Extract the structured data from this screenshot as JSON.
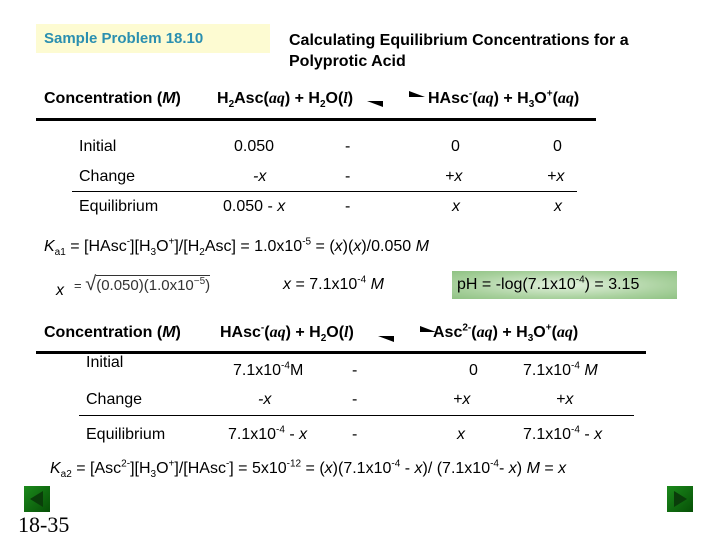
{
  "header": {
    "sample_problem": "Sample Problem 18.10",
    "title_line1": "Calculating Equilibrium Concentrations for a",
    "title_line2": "Polyprotic Acid"
  },
  "table1": {
    "conc_label": "Concentration (",
    "conc_unit": "M",
    "conc_close": ")",
    "reaction": {
      "r1": "H",
      "r1_sub": "2",
      "r1_rest": "Asc(",
      "r1_state": "aq",
      "r1_close": ") + H",
      "r2_sub": "2",
      "r2_rest": "O(",
      "r2_state": "l",
      "r2_close": ")",
      "p1": "HAsc",
      "p1_sup": "-",
      "p1_rest": "(",
      "p1_state": "aq",
      "p1_close": ") + H",
      "p2_sub": "3",
      "p2_rest": "O",
      "p2_sup": "+",
      "p2_open": "(",
      "p2_state": "aq",
      "p2_close": ")"
    },
    "rows": [
      {
        "label": "Initial",
        "c1": "0.050",
        "c2": "-",
        "c3": "0",
        "c4": "0"
      },
      {
        "label": "Change",
        "c1": "-x",
        "c2": "-",
        "c3": "+x",
        "c4": "+x"
      },
      {
        "label": "Equilibrium",
        "c1": "0.050 - ",
        "c1_var": "x",
        "c2": "-",
        "c3": "x",
        "c4": "x"
      }
    ]
  },
  "ka1": {
    "K": "K",
    "sub": "a1",
    "expr1": " = [HAsc",
    "sup1": "-",
    "expr2": "][H",
    "sub2": "3",
    "expr3": "O",
    "sup3": "+",
    "expr4": "]/[H",
    "sub4": "2",
    "expr5": "Asc] = 1.0x10",
    "sup5": "-5",
    "expr6": " = (",
    "var": "x",
    "expr7": ")(",
    "expr8": ")/0.050 ",
    "unit": "M"
  },
  "solve": {
    "x_var": "x",
    "sqrt_expr": "(0.050)(1.0x10",
    "sqrt_exp": "−5",
    "sqrt_close": ")",
    "result_var": "x",
    "result": " = 7.1x10",
    "result_exp": "-4",
    "result_unit": "M"
  },
  "ph": {
    "prefix": "pH = -log(7.1x10",
    "exp": "-4",
    "suffix": ") = 3.15",
    "box_color": "#a9d19e"
  },
  "table2": {
    "conc_label": "Concentration (",
    "conc_unit": "M",
    "conc_close": ")",
    "reaction": {
      "r1": "HAsc",
      "r1_sup": "-",
      "r1_rest": "(",
      "r1_state": "aq",
      "r1_close": ") + H",
      "r2_sub": "2",
      "r2_rest": "O(",
      "r2_state": "l",
      "r2_close": ")",
      "p1": "Asc",
      "p1_sup": "2-",
      "p1_rest": "(",
      "p1_state": "aq",
      "p1_close": ") + H",
      "p2_sub": "3",
      "p2_rest": "O",
      "p2_sup": "+",
      "p2_open": "(",
      "p2_state": "aq",
      "p2_close": ")"
    },
    "rows": [
      {
        "label": "Initial",
        "c1": "7.1x10",
        "c1_exp": "-4",
        "c1_unit": "M",
        "c2": "-",
        "c3": "0",
        "c4": "7.1x10",
        "c4_exp": "-4",
        "c4_unit": "M"
      },
      {
        "label": "Change",
        "c1": "-x",
        "c2": "-",
        "c3": "+x",
        "c4": "+x"
      },
      {
        "label": "Equilibrium",
        "c1": "7.1x10",
        "c1_exp": "-4",
        "c1_rest": " - ",
        "c1_var": "x",
        "c2": "-",
        "c3": "x",
        "c4": "7.1x10",
        "c4_exp": "-4",
        "c4_rest": " - ",
        "c4_var": "x"
      }
    ]
  },
  "ka2": {
    "K": "K",
    "sub": "a2",
    "expr1": " = [Asc",
    "sup1": "2-",
    "expr2": "][H",
    "sub2": "3",
    "expr3": "O",
    "sup3": "+",
    "expr4": "]/[HAsc",
    "sup4": "-",
    "expr5": "] = 5x10",
    "sup5": "-12",
    "expr6": " = (",
    "var": "x",
    "expr7": ")(7.1x10",
    "sup7": "-4",
    "expr8": " - ",
    "expr9": ")/ (7.1x10",
    "sup9": "-4",
    "expr10": "- ",
    "expr11": ") ",
    "unit": "M",
    "expr12": " = "
  },
  "nav": {
    "prev": "previous-slide",
    "next": "next-slide"
  },
  "slide_number": "18-35"
}
